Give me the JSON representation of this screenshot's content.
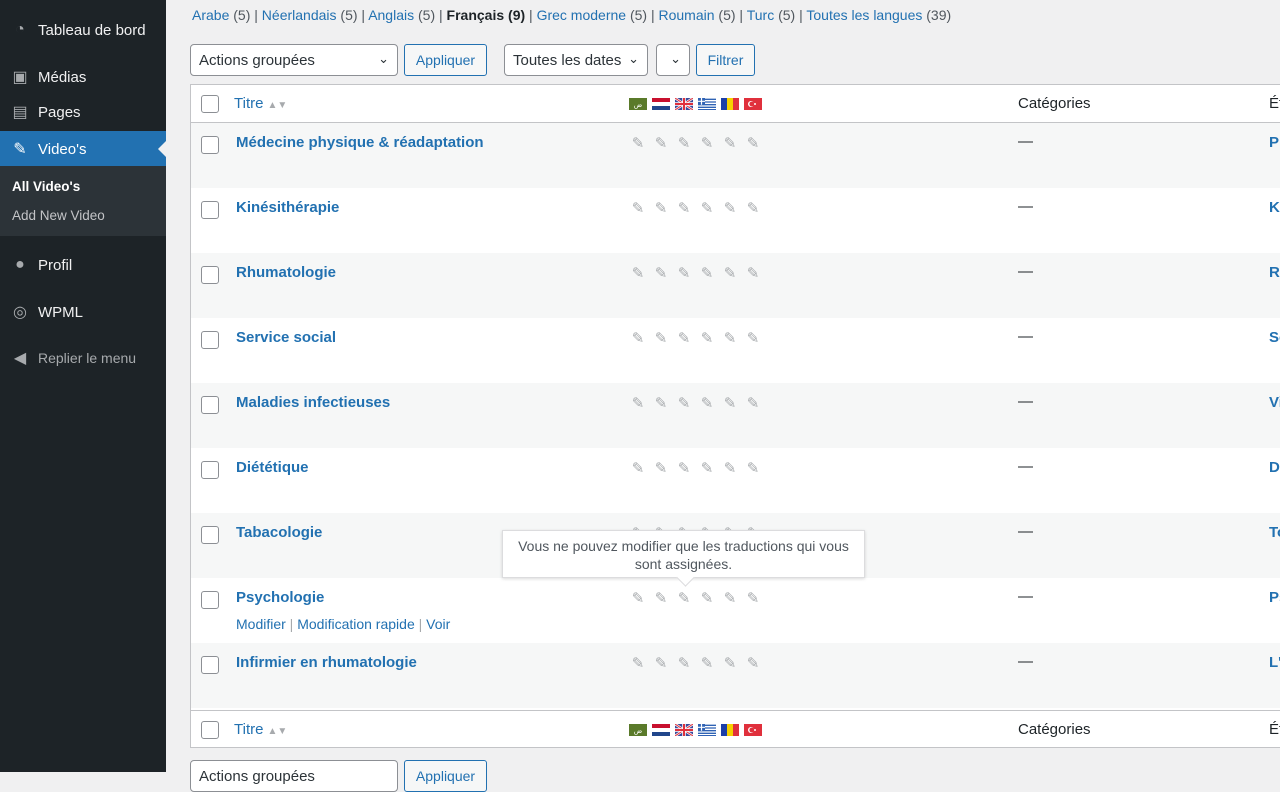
{
  "sidebar": {
    "items": [
      {
        "label": "Tableau de bord",
        "icon": "dashboard-icon"
      },
      {
        "label": "Médias",
        "icon": "media-icon"
      },
      {
        "label": "Pages",
        "icon": "pages-icon"
      },
      {
        "label": "Video's",
        "icon": "pin-icon"
      },
      {
        "label": "Profil",
        "icon": "user-icon"
      },
      {
        "label": "WPML",
        "icon": "wpml-icon"
      }
    ],
    "submenu": [
      "All Video's",
      "Add New Video"
    ],
    "collapse": "Replier le menu"
  },
  "languages": [
    {
      "label": "Arabe",
      "count": "(5)"
    },
    {
      "label": "Néerlandais",
      "count": "(5)"
    },
    {
      "label": "Anglais",
      "count": "(5)"
    },
    {
      "label": "Français",
      "count": "(9)"
    },
    {
      "label": "Grec moderne",
      "count": "(5)"
    },
    {
      "label": "Roumain",
      "count": "(5)"
    },
    {
      "label": "Turc",
      "count": "(5)"
    },
    {
      "label": "Toutes les langues",
      "count": "(39)"
    }
  ],
  "toolbar": {
    "bulk": "Actions groupées",
    "apply": "Appliquer",
    "dates": "Toutes les dates",
    "filter": "Filtrer"
  },
  "columns": {
    "title": "Titre",
    "categories": "Catégories",
    "state": "Ét"
  },
  "rows": [
    {
      "title": "Médecine physique & réadaptation",
      "cat": "—",
      "state": "Pl"
    },
    {
      "title": "Kinésithérapie",
      "cat": "—",
      "state": "Ki"
    },
    {
      "title": "Rhumatologie",
      "cat": "—",
      "state": "Rl"
    },
    {
      "title": "Service social",
      "cat": "—",
      "state": "Se"
    },
    {
      "title": "Maladies infectieuses",
      "cat": "—",
      "state": "Vi"
    },
    {
      "title": "Diététique",
      "cat": "—",
      "state": "Di"
    },
    {
      "title": "Tabacologie",
      "cat": "—",
      "state": "To"
    },
    {
      "title": "Psychologie",
      "cat": "—",
      "state": "Ps"
    },
    {
      "title": "Infirmier en rhumatologie",
      "cat": "—",
      "state": "L'"
    }
  ],
  "row_actions": [
    "Modifier",
    "Modification rapide",
    "Voir"
  ],
  "tooltip": "Vous ne pouvez modifier que les traductions qui vous sont assignées.",
  "colors": {
    "accent": "#2271b1",
    "sidebar": "#1d2327"
  }
}
